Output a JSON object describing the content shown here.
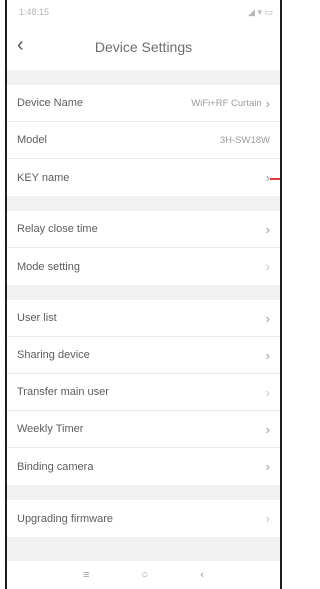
{
  "status": {
    "time": "1:48:15",
    "icons": "◢ ▾ ▭"
  },
  "header": {
    "back_icon": "‹",
    "title": "Device Settings"
  },
  "groups": [
    [
      {
        "label": "Device Name",
        "value": "WiFi+RF Curtain",
        "chevron": true
      },
      {
        "label": "Model",
        "value": "3H-SW18W",
        "chevron": false
      },
      {
        "label": "KEY name",
        "value": "",
        "chevron": true,
        "marker": true
      }
    ],
    [
      {
        "label": "Relay close time",
        "value": "",
        "chevron": true
      },
      {
        "label": "Mode setting",
        "value": "",
        "chevron": true,
        "light": true
      }
    ],
    [
      {
        "label": "User list",
        "value": "",
        "chevron": true
      },
      {
        "label": "Sharing device",
        "value": "",
        "chevron": true
      },
      {
        "label": "Transfer main user",
        "value": "",
        "chevron": true,
        "light": true
      },
      {
        "label": "Weekly Timer",
        "value": "",
        "chevron": true
      },
      {
        "label": "Binding camera",
        "value": "",
        "chevron": true
      }
    ],
    [
      {
        "label": "Upgrading firmware",
        "value": "",
        "chevron": true,
        "light": true
      }
    ]
  ],
  "navbar": {
    "menu": "≡",
    "home": "○",
    "back": "‹"
  },
  "colors": {
    "marker": "#e0383e"
  }
}
